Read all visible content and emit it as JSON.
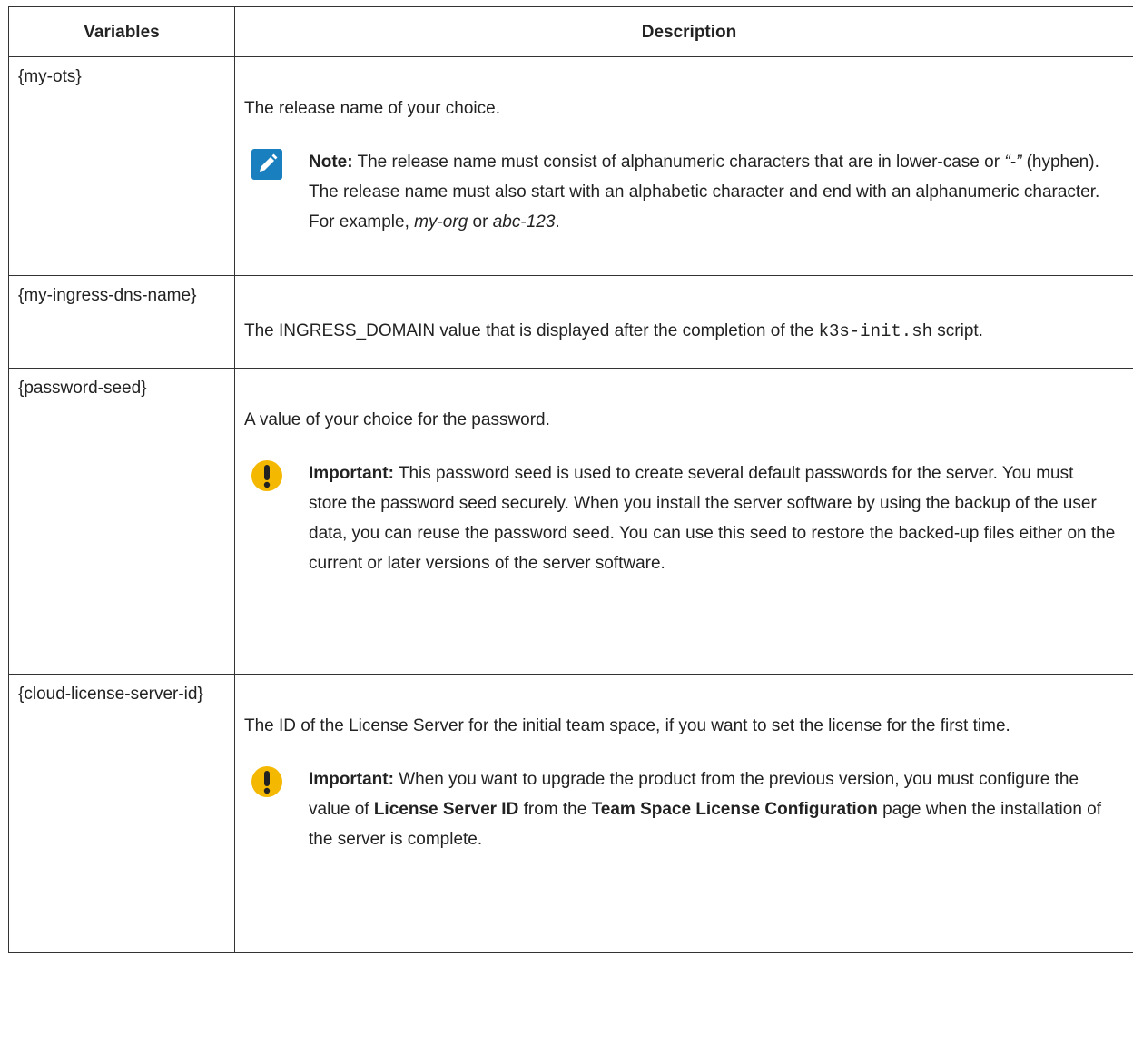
{
  "headers": {
    "col1": "Variables",
    "col2": "Description"
  },
  "rows": [
    {
      "variable": "{my-ots}",
      "description": "The release name of your choice.",
      "note": {
        "label": "Note:",
        "t1": " The release name must consist of alphanumeric characters that are in lower-case or ",
        "hyphen": "“-”",
        "t2": " (hyphen). The release name must also start with an alphabetic character and end with an alphanumeric character. For example, ",
        "ex1": "my-org",
        "t3": " or ",
        "ex2": "abc-123",
        "t4": "."
      }
    },
    {
      "variable": "{my-ingress-dns-name}",
      "d1": "The INGRESS_DOMAIN value that is displayed after the completion of the ",
      "code": "k3s-init.sh",
      "d2": " script."
    },
    {
      "variable": "{password-seed}",
      "description": "A value of your choice for the password.",
      "important": {
        "label": "Important:",
        "text": " This password seed is used to create several default passwords for the server. You must store the password seed securely. When you install the server software by using the backup of the user data, you can reuse the password seed. You can use this seed to restore the backed-up files either on the current or later versions of the server software."
      }
    },
    {
      "variable": "{cloud-license-server-id}",
      "description": "The ID of the License Server for the initial team space, if you want to set the license for the first time.",
      "important": {
        "label": "Important:",
        "t1": " When you want to upgrade the product from the previous version, you must configure the value of ",
        "b1": "License Server ID",
        "t2": " from the ",
        "b2": "Team Space License Configuration",
        "t3": " page when the installation of the server is complete."
      }
    }
  ],
  "colors": {
    "note_icon": "#1a7fbf",
    "important_icon": "#f5b800",
    "border": "#333333"
  },
  "icons": {
    "note": "pencil-icon",
    "important": "exclamation-icon"
  }
}
